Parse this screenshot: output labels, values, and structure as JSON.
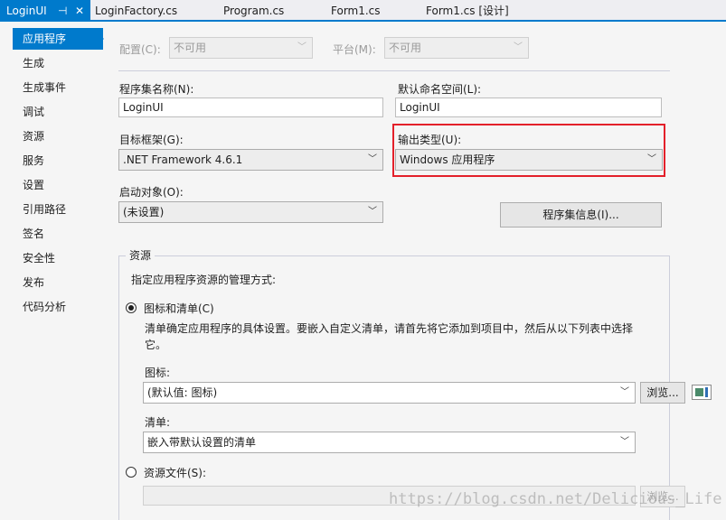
{
  "tabs": [
    {
      "label": "LoginUI",
      "active": true
    },
    {
      "label": "LoginFactory.cs",
      "active": false
    },
    {
      "label": "Program.cs",
      "active": false
    },
    {
      "label": "Form1.cs",
      "active": false
    },
    {
      "label": "Form1.cs [设计]",
      "active": false
    }
  ],
  "tab_pin_icon": "⊣",
  "tab_close_icon": "✕",
  "sidebar": {
    "items": [
      {
        "label": "应用程序",
        "active": true
      },
      {
        "label": "生成"
      },
      {
        "label": "生成事件"
      },
      {
        "label": "调试"
      },
      {
        "label": "资源"
      },
      {
        "label": "服务"
      },
      {
        "label": "设置"
      },
      {
        "label": "引用路径"
      },
      {
        "label": "签名"
      },
      {
        "label": "安全性"
      },
      {
        "label": "发布"
      },
      {
        "label": "代码分析"
      }
    ]
  },
  "config": {
    "label": "配置(C):",
    "value": "不可用"
  },
  "platform": {
    "label": "平台(M):",
    "value": "不可用"
  },
  "assembly_name": {
    "label": "程序集名称(N):",
    "value": "LoginUI"
  },
  "default_namespace": {
    "label": "默认命名空间(L):",
    "value": "LoginUI"
  },
  "target_framework": {
    "label": "目标框架(G):",
    "value": ".NET Framework 4.6.1"
  },
  "output_type": {
    "label": "输出类型(U):",
    "value": "Windows 应用程序"
  },
  "startup_object": {
    "label": "启动对象(O):",
    "value": "(未设置)"
  },
  "assembly_info_button": "程序集信息(I)...",
  "resources": {
    "group_title": "资源",
    "instruction": "指定应用程序资源的管理方式:",
    "icon_manifest_option": "图标和清单(C)",
    "icon_manifest_selected": true,
    "description": "清单确定应用程序的具体设置。要嵌入自定义清单，请首先将它添加到项目中，然后从以下列表中选择它。",
    "icon_label": "图标:",
    "icon_value": "(默认值: 图标)",
    "browse_label": "浏览...",
    "manifest_label": "清单:",
    "manifest_value": "嵌入带默认设置的清单",
    "resource_file_option": "资源文件(S):",
    "resource_file_value": "",
    "resource_browse_label": "浏览..."
  },
  "watermark": "https://blog.csdn.net/Delicious_Life",
  "colors": {
    "accent": "#007ACC",
    "highlight_box": "#E3202A",
    "background": "#F5F5F5"
  }
}
